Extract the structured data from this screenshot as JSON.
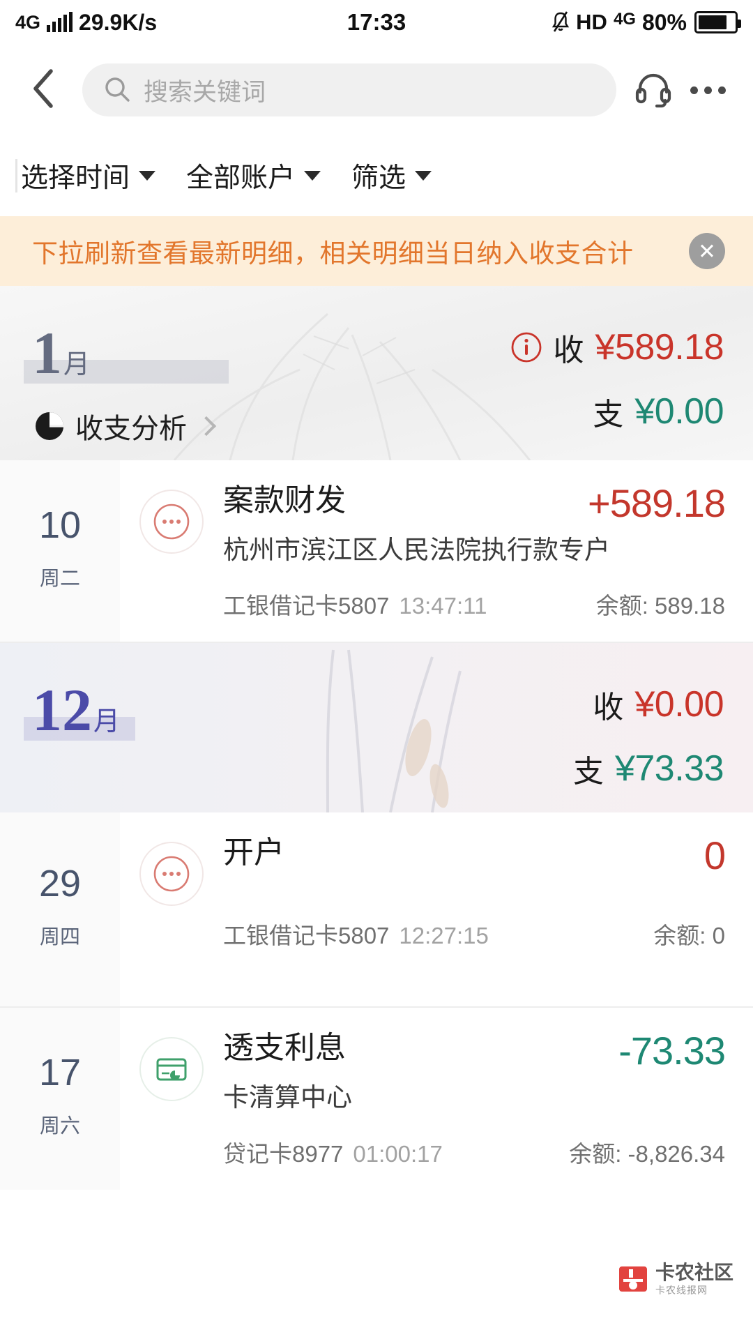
{
  "statusbar": {
    "network": "4G",
    "speed": "29.9K/s",
    "time": "17:33",
    "hd": "HD",
    "network2": "4G",
    "battery_pct": "80%",
    "mute_icon": "mute-bell-icon",
    "signal_icon": "signal-bars-icon",
    "battery_icon": "battery-icon"
  },
  "header": {
    "back_icon": "chevron-left-icon",
    "search_icon": "search-icon",
    "search_placeholder": "搜索关键词",
    "search_value": "",
    "support_icon": "headset-icon",
    "more_icon": "more-dots-icon"
  },
  "filters": [
    {
      "label": "选择时间",
      "name": "filter-time"
    },
    {
      "label": "全部账户",
      "name": "filter-account"
    },
    {
      "label": "筛选",
      "name": "filter-more"
    }
  ],
  "banner": {
    "text": "下拉刷新查看最新明细，相关明细当日纳入收支合计",
    "close_label": "✕",
    "bg_color": "#fdeed9",
    "text_color": "#e2762c"
  },
  "months": [
    {
      "num": "1",
      "suffix": "月",
      "info_icon": "info-icon",
      "income_label": "收",
      "income_value": "¥589.18",
      "expense_label": "支",
      "expense_value": "¥0.00",
      "analysis_label": "收支分析",
      "analysis_icon": "pie-chart-icon",
      "has_analysis": true
    },
    {
      "num": "12",
      "suffix": "月",
      "income_label": "收",
      "income_value": "¥0.00",
      "expense_label": "支",
      "expense_value": "¥73.33",
      "has_analysis": false
    }
  ],
  "transactions": [
    {
      "day": "10",
      "weekday": "周二",
      "icon": "more-dots-circle-icon",
      "title": "案款财发",
      "subtitle": "杭州市滨江区人民法院执行款专户",
      "amount": "+589.18",
      "amount_type": "pos",
      "card": "工银借记卡5807",
      "time": "13:47:11",
      "balance": "余额: 589.18"
    },
    {
      "day": "29",
      "weekday": "周四",
      "icon": "more-dots-circle-icon",
      "title": "开户",
      "subtitle": "",
      "amount": "0",
      "amount_type": "pos",
      "card": "工银借记卡5807",
      "time": "12:27:15",
      "balance": "余额: 0"
    },
    {
      "day": "17",
      "weekday": "周六",
      "icon": "credit-card-icon",
      "title": "透支利息",
      "subtitle": "卡清算中心",
      "amount": "-73.33",
      "amount_type": "neg",
      "card": "贷记卡8977",
      "time": "01:00:17",
      "balance": "余额: -8,826.34"
    }
  ],
  "watermark": {
    "main": "卡农社区",
    "sub": "卡农线报网"
  },
  "colors": {
    "income_red": "#c9342a",
    "expense_teal": "#1e8873",
    "banner_orange": "#e2762c"
  }
}
